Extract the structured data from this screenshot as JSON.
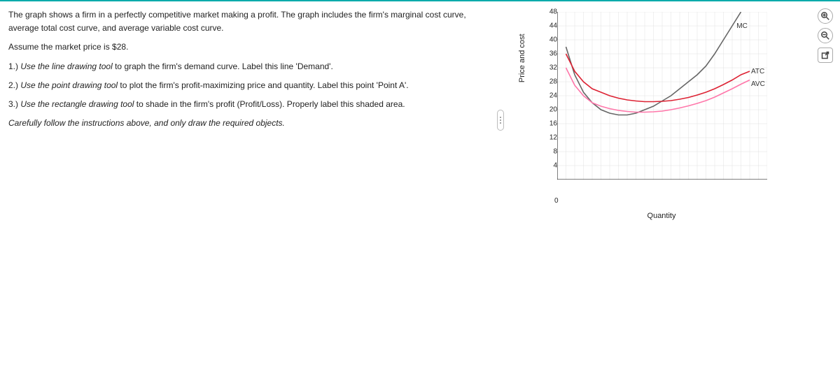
{
  "instructions": {
    "intro": "The graph shows a firm in a perfectly competitive market making a profit.  The graph includes the firm's marginal cost curve, average total cost curve, and average variable cost curve.",
    "assume": "Assume the market price is $28.",
    "step1_pre": "1.) ",
    "step1_tool": "Use the line drawing tool",
    "step1_rest": " to graph the firm's demand curve. Label this line 'Demand'.",
    "step2_pre": "2.) ",
    "step2_tool": "Use the point drawing tool",
    "step2_rest": " to plot the firm's profit-maximizing price and quantity. Label this point 'Point A'.",
    "step3_pre": "3.) ",
    "step3_tool": "Use the rectangle drawing tool",
    "step3_rest": " to shade in the firm's profit (Profit/Loss). Properly label this shaded area.",
    "careful": "Carefully follow the instructions above, and only draw the required objects."
  },
  "chart_data": {
    "type": "line",
    "title": "",
    "xlabel": "Quantity",
    "ylabel": "Price and cost",
    "ylim": [
      0,
      48
    ],
    "xlim": [
      0,
      24
    ],
    "y_ticks": [
      0,
      4,
      8,
      12,
      16,
      20,
      24,
      28,
      32,
      36,
      40,
      44,
      48
    ],
    "x_ticks_count": 24,
    "series": [
      {
        "name": "MC",
        "color": "#666",
        "points": [
          [
            1,
            38
          ],
          [
            2,
            30
          ],
          [
            3,
            25
          ],
          [
            4,
            22
          ],
          [
            5,
            20
          ],
          [
            6,
            19
          ],
          [
            7,
            18.5
          ],
          [
            8,
            18.5
          ],
          [
            9,
            19
          ],
          [
            10,
            20
          ],
          [
            11,
            21
          ],
          [
            12,
            22.5
          ],
          [
            13,
            24
          ],
          [
            14,
            26
          ],
          [
            15,
            28
          ],
          [
            16,
            30
          ],
          [
            17,
            32.5
          ],
          [
            18,
            36
          ],
          [
            19,
            40
          ],
          [
            20,
            44
          ],
          [
            21,
            48
          ]
        ]
      },
      {
        "name": "ATC",
        "color": "#d23",
        "points": [
          [
            1,
            36
          ],
          [
            2,
            31
          ],
          [
            3,
            28
          ],
          [
            4,
            26
          ],
          [
            5,
            25
          ],
          [
            6,
            24
          ],
          [
            7,
            23.3
          ],
          [
            8,
            22.8
          ],
          [
            9,
            22.5
          ],
          [
            10,
            22.3
          ],
          [
            11,
            22.3
          ],
          [
            12,
            22.4
          ],
          [
            13,
            22.6
          ],
          [
            14,
            23
          ],
          [
            15,
            23.5
          ],
          [
            16,
            24.2
          ],
          [
            17,
            25
          ],
          [
            18,
            26
          ],
          [
            19,
            27.2
          ],
          [
            20,
            28.5
          ],
          [
            21,
            30
          ],
          [
            22,
            31
          ]
        ]
      },
      {
        "name": "AVC",
        "color": "#f7a",
        "points": [
          [
            1,
            32
          ],
          [
            2,
            27
          ],
          [
            3,
            24
          ],
          [
            4,
            22
          ],
          [
            5,
            21
          ],
          [
            6,
            20.3
          ],
          [
            7,
            19.8
          ],
          [
            8,
            19.5
          ],
          [
            9,
            19.3
          ],
          [
            10,
            19.3
          ],
          [
            11,
            19.4
          ],
          [
            12,
            19.6
          ],
          [
            13,
            20
          ],
          [
            14,
            20.5
          ],
          [
            15,
            21.1
          ],
          [
            16,
            21.8
          ],
          [
            17,
            22.6
          ],
          [
            18,
            23.6
          ],
          [
            19,
            24.8
          ],
          [
            20,
            26
          ],
          [
            21,
            27.3
          ],
          [
            22,
            28.5
          ]
        ]
      }
    ],
    "curve_labels": {
      "MC": "MC",
      "ATC": "ATC",
      "AVC": "AVC"
    }
  }
}
